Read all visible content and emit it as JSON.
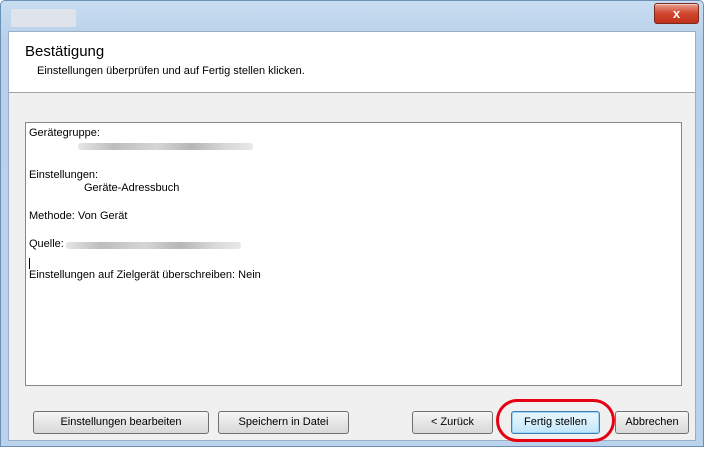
{
  "window": {
    "close_symbol": "x"
  },
  "header": {
    "title": "Bestätigung",
    "subtitle": "Einstellungen überprüfen und auf Fertig stellen klicken."
  },
  "summary": {
    "device_group_label": "Gerätegruppe:",
    "settings_label": "Einstellungen:",
    "settings_value": "Geräte-Adressbuch",
    "method_line": "Methode: Von Gerät",
    "source_label": "Quelle:",
    "overwrite_line": "Einstellungen auf Zielgerät überschreiben: Nein"
  },
  "buttons": {
    "edit_settings": "Einstellungen bearbeiten",
    "save_to_file": "Speichern in Datei",
    "back": "< Zurück",
    "finish": "Fertig stellen",
    "cancel": "Abbrechen"
  },
  "colors": {
    "highlight": "#e60012",
    "close_button": "#c0301a"
  }
}
